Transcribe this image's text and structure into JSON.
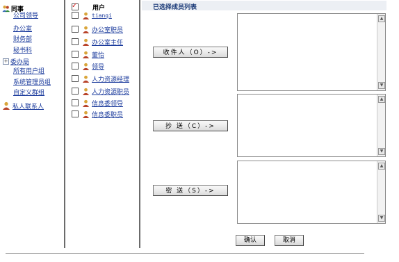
{
  "tree": {
    "root_label": "同事",
    "items": [
      "公司领导",
      "办公室",
      "财务部",
      "秘书科",
      "委办局",
      "所有用户组",
      "系统管理员组",
      "自定义群组"
    ],
    "expandable_item": "委办局",
    "private_contacts": "私人联系人"
  },
  "users": {
    "header_label": "用户",
    "list": [
      {
        "name": "tianqi",
        "checked": false
      },
      {
        "name": "办公室职员",
        "checked": false
      },
      {
        "name": "办公室主任",
        "checked": false
      },
      {
        "name": "董怡",
        "checked": false
      },
      {
        "name": "领导",
        "checked": false
      },
      {
        "name": "人力资源经理",
        "checked": false
      },
      {
        "name": "人力资源职员",
        "checked": false
      },
      {
        "name": "信息委领导",
        "checked": false
      },
      {
        "name": "信息委职员",
        "checked": false
      }
    ]
  },
  "panel": {
    "title": "已选择成员列表",
    "to_button": "收件人（O）->",
    "cc_button": "抄 送（C）->",
    "bcc_button": "密 送（S）->"
  },
  "actions": {
    "confirm": "确认",
    "cancel": "取消"
  },
  "icons": {
    "root": "people-icon",
    "user": "person-icon",
    "expand": "plus-expander-icon"
  },
  "colors": {
    "link": "#1a3a9c",
    "title_bg": "#eceff4",
    "title_text": "#1a3a78",
    "separator": "#6b6b6b"
  }
}
